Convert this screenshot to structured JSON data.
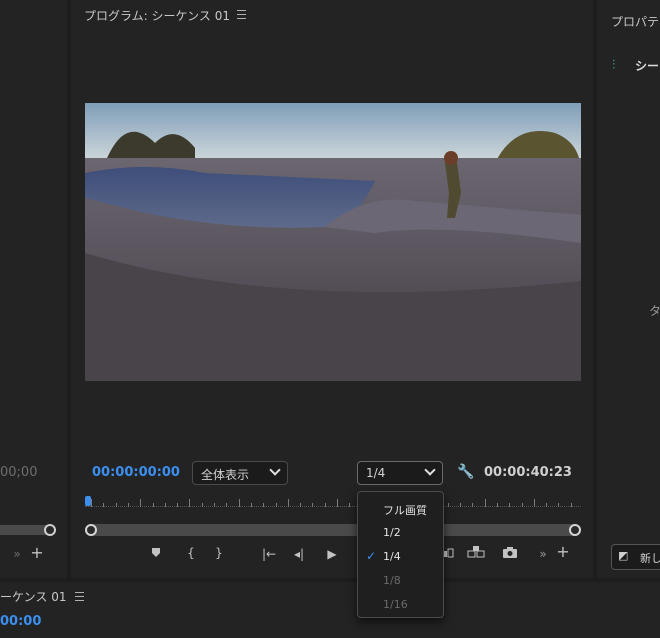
{
  "program_monitor": {
    "title": "プログラム: シーケンス 01",
    "timecode_current": "00:00:00:00",
    "zoom_select": "全体表示",
    "resolution_select": "1/4",
    "timecode_duration": "00:00:40:23"
  },
  "resolution_menu": {
    "items": [
      {
        "label": "フル画質",
        "enabled": true,
        "checked": false
      },
      {
        "label": "1/2",
        "enabled": true,
        "checked": false
      },
      {
        "label": "1/4",
        "enabled": true,
        "checked": true
      },
      {
        "label": "1/8",
        "enabled": false,
        "checked": false
      },
      {
        "label": "1/16",
        "enabled": false,
        "checked": false
      }
    ]
  },
  "source_monitor": {
    "timecode_partial": "00;00"
  },
  "properties_panel": {
    "title": "プロパティ",
    "item_label": "シー",
    "partial_label": "タ",
    "new_button_partial": "新し"
  },
  "timeline_panel": {
    "title": "ーケンス 01",
    "timecode_partial": "00:00"
  },
  "colors": {
    "accent": "#3b8ff0",
    "panel_bg": "#232323",
    "app_bg": "#1d1d1d"
  }
}
